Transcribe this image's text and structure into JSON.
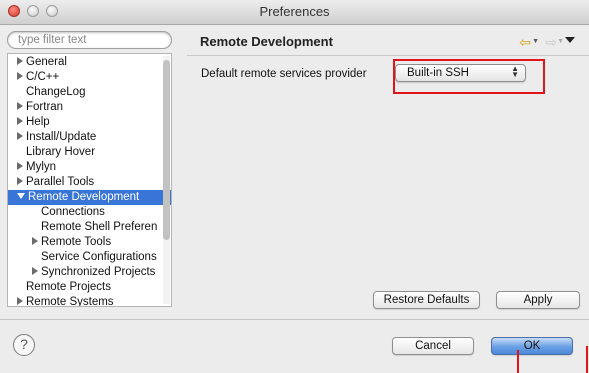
{
  "window": {
    "title": "Preferences"
  },
  "filter": {
    "placeholder": "type filter text",
    "value": ""
  },
  "tree": {
    "items": [
      {
        "label": "General",
        "expandable": true,
        "level": 0,
        "selected": false
      },
      {
        "label": "C/C++",
        "expandable": true,
        "level": 0,
        "selected": false
      },
      {
        "label": "ChangeLog",
        "expandable": false,
        "level": 0,
        "selected": false
      },
      {
        "label": "Fortran",
        "expandable": true,
        "level": 0,
        "selected": false
      },
      {
        "label": "Help",
        "expandable": true,
        "level": 0,
        "selected": false
      },
      {
        "label": "Install/Update",
        "expandable": true,
        "level": 0,
        "selected": false
      },
      {
        "label": "Library Hover",
        "expandable": false,
        "level": 0,
        "selected": false
      },
      {
        "label": "Mylyn",
        "expandable": true,
        "level": 0,
        "selected": false
      },
      {
        "label": "Parallel Tools",
        "expandable": true,
        "level": 0,
        "selected": false
      },
      {
        "label": "Remote Development",
        "expandable": true,
        "expanded": true,
        "level": 0,
        "selected": true
      },
      {
        "label": "Connections",
        "expandable": false,
        "level": 1,
        "selected": false
      },
      {
        "label": "Remote Shell Preferen",
        "expandable": false,
        "level": 1,
        "selected": false
      },
      {
        "label": "Remote Tools",
        "expandable": true,
        "level": 1,
        "selected": false
      },
      {
        "label": "Service Configurations",
        "expandable": false,
        "level": 1,
        "selected": false
      },
      {
        "label": "Synchronized Projects",
        "expandable": true,
        "level": 1,
        "selected": false
      },
      {
        "label": "Remote Projects",
        "expandable": false,
        "level": 0,
        "selected": false
      },
      {
        "label": "Remote Systems",
        "expandable": true,
        "level": 0,
        "selected": false
      }
    ]
  },
  "page": {
    "title": "Remote Development",
    "provider_label": "Default remote services provider",
    "provider_value": "Built-in SSH",
    "restore_defaults": "Restore Defaults",
    "apply": "Apply"
  },
  "nav": {
    "back_icon": "back-arrow-icon",
    "forward_icon": "forward-arrow-icon",
    "menu_icon": "view-menu-icon"
  },
  "footer": {
    "help_glyph": "?",
    "cancel": "Cancel",
    "ok": "OK"
  },
  "colors": {
    "selection": "#3875d7",
    "annotation_red": "#e0151c",
    "default_button": "#6a9fe3"
  }
}
